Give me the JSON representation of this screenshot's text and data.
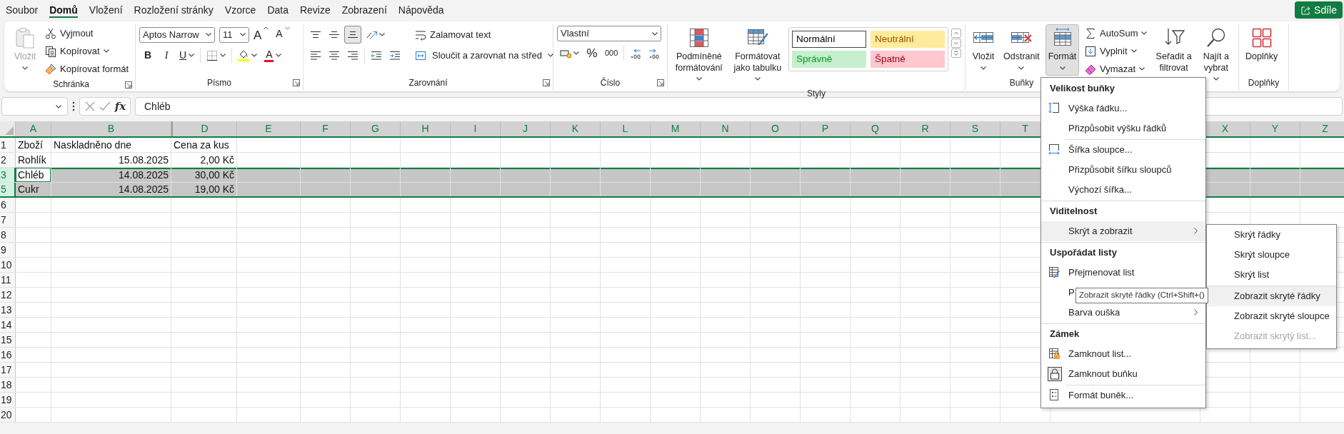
{
  "tabs": [
    {
      "label": "Soubor",
      "selected": false
    },
    {
      "label": "Domů",
      "selected": true
    },
    {
      "label": "Vložení",
      "selected": false
    },
    {
      "label": "Rozložení stránky",
      "selected": false
    },
    {
      "label": "Vzorce",
      "selected": false
    },
    {
      "label": "Data",
      "selected": false
    },
    {
      "label": "Revize",
      "selected": false
    },
    {
      "label": "Zobrazení",
      "selected": false
    },
    {
      "label": "Nápověda",
      "selected": false
    }
  ],
  "share_button": {
    "label": "Sdíle"
  },
  "ribbon": {
    "groups": [
      {
        "kind": "clipboard",
        "label": "Schránka",
        "launcher": true,
        "paste": {
          "label": "Vložit",
          "disabled": true
        },
        "buttons": [
          {
            "label": "Vyjmout",
            "dropdown": false
          },
          {
            "label": "Kopírovat",
            "dropdown": true
          },
          {
            "label": "Kopírovat formát",
            "dropdown": false
          }
        ]
      },
      {
        "kind": "font",
        "label": "Písmo",
        "launcher": true,
        "font_name": "Aptos Narrow",
        "font_size": "11",
        "grow": "A",
        "shrink": "A",
        "bold": "B",
        "italic": "I",
        "underline": "U",
        "font_color": "A"
      },
      {
        "kind": "alignment",
        "label": "Zarovnání",
        "launcher": true,
        "vertical_align": [
          {
            "selected": false
          },
          {
            "selected": false
          },
          {
            "selected": true
          }
        ],
        "horizontal_align": [
          {
            "selected": false
          },
          {
            "selected": false
          },
          {
            "selected": false
          }
        ],
        "wrap_text": "Zalamovat text",
        "merge": "Sloučit a zarovnat na střed"
      },
      {
        "kind": "number",
        "label": "Číslo",
        "launcher": true,
        "format": "Vlastní",
        "percent": "%",
        "thousands": "000"
      },
      {
        "kind": "styles",
        "label": "Styly",
        "buttons": [
          {
            "label": "Podmíněné\nformátování"
          },
          {
            "label": "Formátovat\njako tabulku"
          }
        ],
        "gallery": [
          {
            "label": "Normální",
            "selected": true,
            "color": "#ffffff"
          },
          {
            "label": "Neutrální",
            "selected": false,
            "color": "#ffeb9c"
          },
          {
            "label": "Správně",
            "selected": false,
            "color": "#c6efce"
          },
          {
            "label": "Špatně",
            "selected": false,
            "color": "#ffc7ce"
          }
        ]
      },
      {
        "kind": "cells",
        "label": "Buňky",
        "buttons": [
          {
            "label": "Vložit",
            "selected": false
          },
          {
            "label": "Odstranit",
            "selected": false
          },
          {
            "label": "Formát",
            "selected": true
          }
        ]
      },
      {
        "kind": "editing",
        "small_buttons": [
          {
            "label": "AutoSum"
          },
          {
            "label": "Vyplnit"
          },
          {
            "label": "Vymazat"
          }
        ],
        "buttons": [
          {
            "label": "Seřadit a\nfiltrovat"
          },
          {
            "label": "Najít a\nvybrat"
          }
        ]
      },
      {
        "kind": "addins",
        "label": "Doplňky",
        "buttons": [
          {
            "label": "Doplňky"
          }
        ]
      }
    ]
  },
  "formula_bar": {
    "function_label": "fx",
    "formula": "Chléb"
  },
  "sheet": {
    "columns": [
      {
        "label": "A",
        "selected": true,
        "hidden_before": false
      },
      {
        "label": "B",
        "selected": true,
        "hidden_before": false
      },
      {
        "label": "D",
        "selected": true,
        "hidden_before": true
      },
      {
        "label": "E",
        "selected": true,
        "hidden_before": false
      },
      {
        "label": "F",
        "selected": true,
        "hidden_before": false
      },
      {
        "label": "G",
        "selected": true,
        "hidden_before": false
      },
      {
        "label": "H",
        "selected": true,
        "hidden_before": false
      },
      {
        "label": "I",
        "selected": true,
        "hidden_before": false
      },
      {
        "label": "J",
        "selected": true,
        "hidden_before": false
      },
      {
        "label": "K",
        "selected": true,
        "hidden_before": false
      },
      {
        "label": "L",
        "selected": true,
        "hidden_before": false
      },
      {
        "label": "M",
        "selected": true,
        "hidden_before": false
      },
      {
        "label": "N",
        "selected": true,
        "hidden_before": false
      },
      {
        "label": "O",
        "selected": true,
        "hidden_before": false
      },
      {
        "label": "P",
        "selected": true,
        "hidden_before": false
      },
      {
        "label": "Q",
        "selected": true,
        "hidden_before": false
      },
      {
        "label": "R",
        "selected": true,
        "hidden_before": false
      },
      {
        "label": "S",
        "selected": true,
        "hidden_before": false
      },
      {
        "label": "T",
        "selected": true,
        "hidden_before": false
      },
      {
        "label": "X",
        "selected": true,
        "hidden_before": false
      },
      {
        "label": "Y",
        "selected": true,
        "hidden_before": false
      },
      {
        "label": "Z",
        "selected": true,
        "hidden_before": false
      }
    ],
    "rows": [
      {
        "label": "1",
        "selected": false,
        "cells": [
          {
            "text": "Zboží",
            "numeric": false,
            "active": false
          },
          {
            "text": "Naskladněno dne",
            "numeric": false,
            "active": false
          },
          {
            "text": "Cena za kus",
            "numeric": false,
            "active": false
          }
        ]
      },
      {
        "label": "2",
        "selected": false,
        "cells": [
          {
            "text": "Rohlík",
            "numeric": false,
            "active": false
          },
          {
            "text": "15.08.2025",
            "numeric": true,
            "active": false
          },
          {
            "text": "2,00 Kč",
            "numeric": true,
            "active": false
          }
        ]
      },
      {
        "label": "3",
        "selected": true,
        "cells": [
          {
            "text": "Chléb",
            "numeric": false,
            "active": true
          },
          {
            "text": "14.08.2025",
            "numeric": true,
            "active": false
          },
          {
            "text": "30,00 Kč",
            "numeric": true,
            "active": false
          }
        ]
      },
      {
        "label": "5",
        "selected": true,
        "cells": [
          {
            "text": "Cukr",
            "numeric": false,
            "active": false
          },
          {
            "text": "14.08.2025",
            "numeric": true,
            "active": false
          },
          {
            "text": "19,00 Kč",
            "numeric": true,
            "active": false
          }
        ]
      },
      {
        "label": "6",
        "selected": false
      },
      {
        "label": "7",
        "selected": false
      },
      {
        "label": "8",
        "selected": false
      },
      {
        "label": "9",
        "selected": false
      },
      {
        "label": "10",
        "selected": false
      },
      {
        "label": "11",
        "selected": false
      },
      {
        "label": "12",
        "selected": false
      },
      {
        "label": "13",
        "selected": false
      },
      {
        "label": "14",
        "selected": false
      },
      {
        "label": "15",
        "selected": false
      },
      {
        "label": "16",
        "selected": false
      },
      {
        "label": "17",
        "selected": false
      },
      {
        "label": "18",
        "selected": false
      },
      {
        "label": "19",
        "selected": false
      },
      {
        "label": "20",
        "selected": false
      }
    ]
  },
  "format_menu": {
    "items": [
      {
        "kind": "header",
        "label": "Velikost buňky"
      },
      {
        "kind": "item",
        "label": "Výška řádku...",
        "selected": false
      },
      {
        "kind": "item",
        "label": "Přizpůsobit výšku řádků",
        "selected": false
      },
      {
        "kind": "separator",
        "inset": true
      },
      {
        "kind": "item",
        "label": "Šířka sloupce...",
        "selected": false
      },
      {
        "kind": "item",
        "label": "Přizpůsobit šířku sloupců",
        "selected": false
      },
      {
        "kind": "item",
        "label": "Výchozí šířka...",
        "selected": false
      },
      {
        "kind": "separator"
      },
      {
        "kind": "header",
        "label": "Viditelnost"
      },
      {
        "kind": "item",
        "label": "Skrýt a zobrazit",
        "selected": true,
        "submenu": true
      },
      {
        "kind": "separator"
      },
      {
        "kind": "header",
        "label": "Uspořádat listy"
      },
      {
        "kind": "item",
        "label": "Přejmenovat list",
        "selected": false
      },
      {
        "kind": "item",
        "label": "P",
        "selected": false
      },
      {
        "kind": "item",
        "label": "Barva ouška",
        "selected": false,
        "submenu": true
      },
      {
        "kind": "separator"
      },
      {
        "kind": "header",
        "label": "Zámek"
      },
      {
        "kind": "item",
        "label": "Zamknout list...",
        "selected": false
      },
      {
        "kind": "item",
        "label": "Zamknout buňku",
        "selected": false,
        "checked": true
      },
      {
        "kind": "separator",
        "inset": true
      },
      {
        "kind": "item",
        "label": "Formát buněk...",
        "selected": false
      }
    ]
  },
  "submenu": {
    "items": [
      {
        "kind": "item",
        "label": "Skrýt řádky",
        "selected": false,
        "disabled": false
      },
      {
        "kind": "item",
        "label": "Skrýt sloupce",
        "selected": false,
        "disabled": false
      },
      {
        "kind": "item",
        "label": "Skrýt list",
        "selected": false,
        "disabled": false
      },
      {
        "kind": "separator"
      },
      {
        "kind": "item",
        "label": "Zobrazit skryté řádky",
        "selected": true,
        "disabled": false
      },
      {
        "kind": "item",
        "label": "Zobrazit skryté sloupce",
        "selected": false,
        "disabled": false
      },
      {
        "kind": "item",
        "label": "Zobrazit skrytý list...",
        "selected": false,
        "disabled": true
      }
    ]
  },
  "tooltip": {
    "text": "Zobrazit skryté řádky (Ctrl+Shift+()"
  }
}
